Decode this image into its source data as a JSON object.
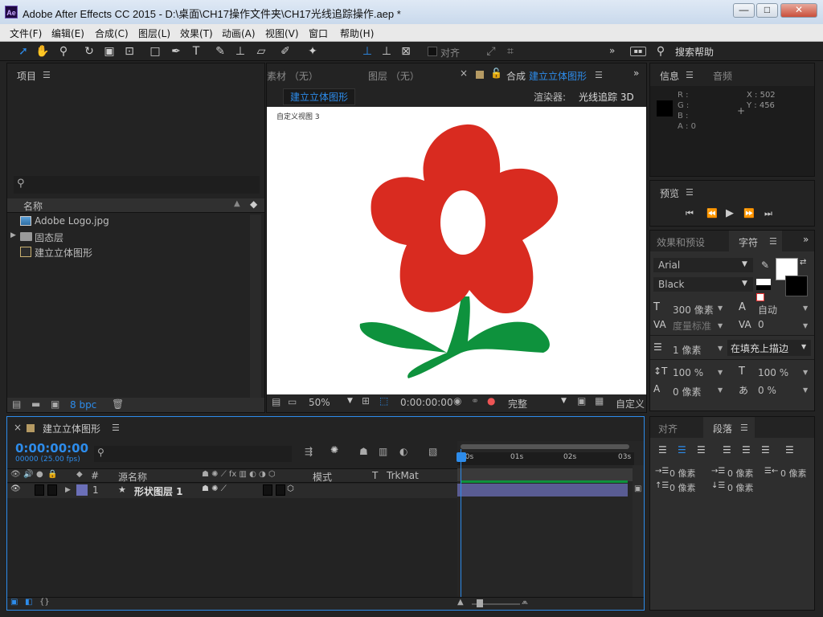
{
  "titlebar": {
    "app_icon": "Ae",
    "title": "Adobe After Effects CC 2015 - D:\\桌面\\CH17操作文件夹\\CH17光线追踪操作.aep *",
    "min": "—",
    "max": "□",
    "close": "✕"
  },
  "menu": [
    "文件(F)",
    "编辑(E)",
    "合成(C)",
    "图层(L)",
    "效果(T)",
    "动画(A)",
    "视图(V)",
    "窗口",
    "帮助(H)"
  ],
  "toolbar": {
    "snap_label": "对齐",
    "more": "»",
    "search_label": "搜索帮助"
  },
  "project": {
    "title": "项目",
    "col_name": "名称",
    "items": [
      {
        "name": "Adobe Logo.jpg",
        "icon": "image-icon"
      },
      {
        "name": "固态层",
        "icon": "folder-icon"
      },
      {
        "name": "建立立体图形",
        "icon": "composition-icon"
      }
    ],
    "bpc": "8 bpc"
  },
  "viewer": {
    "tabs": [
      "素材 （无）",
      "图层 （无）"
    ],
    "comp_tab_prefix": "合成",
    "comp_tab_name": "建立立体图形",
    "comp_label": "建立立体图形",
    "renderer_label": "渲染器:",
    "renderer_value": "光线追踪 3D",
    "view_label": "自定义视图 3",
    "zoom": "50%",
    "timecode": "0:00:00:00",
    "quality": "完整",
    "view_select": "自定义"
  },
  "info": {
    "title": "信息",
    "audio_tab": "音频",
    "r": "R :",
    "g": "G :",
    "b": "B :",
    "a": "A : 0",
    "x": "X : 502",
    "y": "Y : 456"
  },
  "preview": {
    "title": "预览"
  },
  "character": {
    "effects_tab": "效果和预设",
    "title": "字符",
    "font": "Arial",
    "style": "Black",
    "size": "300 像素",
    "leading": "自动",
    "kerning": "度量标准",
    "tracking": "0",
    "stroke_width": "1 像素",
    "stroke_mode": "在填充上描边",
    "vscale": "100 %",
    "hscale": "100 %",
    "baseline": "0 像素",
    "tsume": "0 %"
  },
  "paragraph": {
    "align_tab": "对齐",
    "title": "段落",
    "indent_left": "0 像素",
    "indent_first": "0 像素",
    "indent_right": "0 像素",
    "space_before": "0 像素",
    "space_after": "0 像素"
  },
  "timeline": {
    "comp_name": "建立立体图形",
    "timecode": "0:00:00:00",
    "frames": "00000 (25.00 fps)",
    "col_num": "#",
    "col_source": "源名称",
    "col_mode": "模式",
    "col_t": "T",
    "col_trkmat": "TrkMat",
    "layer_num": "1",
    "layer_name": "形状图层 1",
    "ruler": [
      "00s",
      "01s",
      "02s",
      "03s"
    ]
  },
  "colors": {
    "accent": "#2d8ceb",
    "flower_red": "#d92b20",
    "stem_green": "#0e923d",
    "layer_bar": "#6b6fb8"
  }
}
